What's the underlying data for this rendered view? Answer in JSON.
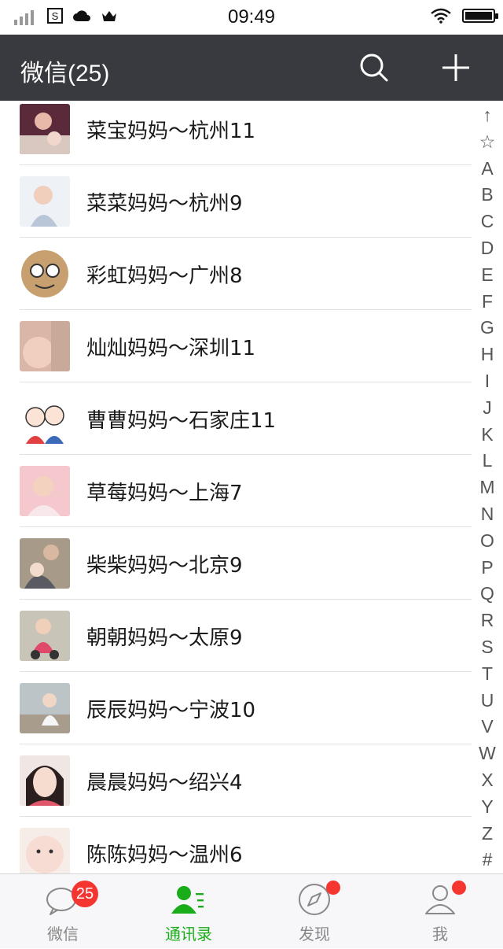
{
  "status_bar": {
    "time": "09:49"
  },
  "nav": {
    "title": "微信(25)"
  },
  "contacts": [
    {
      "name": "菜宝妈妈～杭州11"
    },
    {
      "name": "菜菜妈妈～杭州9"
    },
    {
      "name": "彩虹妈妈～广州8"
    },
    {
      "name": "灿灿妈妈～深圳11"
    },
    {
      "name": "曹曹妈妈～石家庄11"
    },
    {
      "name": "草莓妈妈～上海7"
    },
    {
      "name": "柴柴妈妈～北京9"
    },
    {
      "name": "朝朝妈妈～太原9"
    },
    {
      "name": "辰辰妈妈～宁波10"
    },
    {
      "name": "晨晨妈妈～绍兴4"
    },
    {
      "name": "陈陈妈妈～温州6"
    }
  ],
  "index_letters": [
    "↑",
    "☆",
    "A",
    "B",
    "C",
    "D",
    "E",
    "F",
    "G",
    "H",
    "I",
    "J",
    "K",
    "L",
    "M",
    "N",
    "O",
    "P",
    "Q",
    "R",
    "S",
    "T",
    "U",
    "V",
    "W",
    "X",
    "Y",
    "Z",
    "#"
  ],
  "tabs": [
    {
      "label": "微信",
      "badge": "25"
    },
    {
      "label": "通讯录"
    },
    {
      "label": "发现"
    },
    {
      "label": "我"
    }
  ],
  "colors": {
    "accent": "#1aad19",
    "navbar": "#393a3f",
    "badge": "#f43530"
  }
}
